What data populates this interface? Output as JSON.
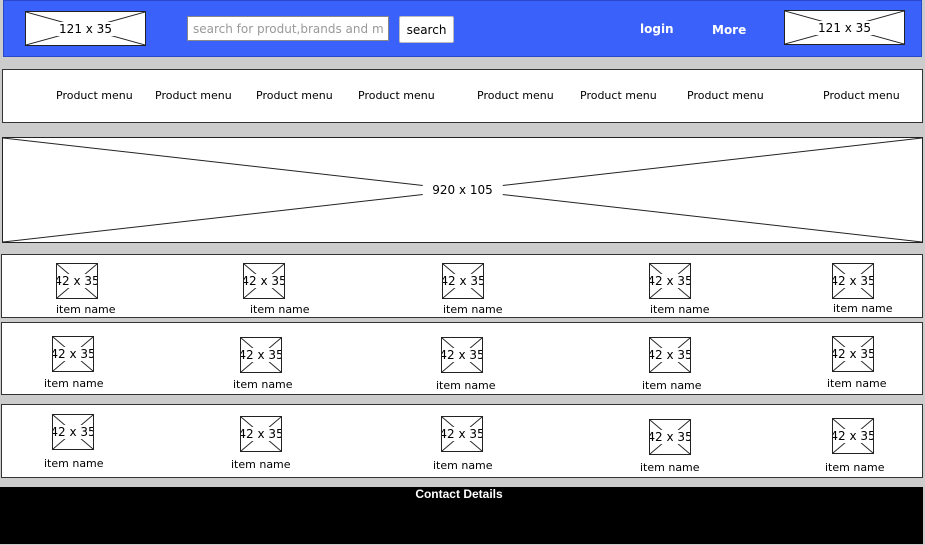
{
  "header": {
    "logo_placeholder": "121 x 35",
    "search": {
      "placeholder": "search for produt,brands and more",
      "button_label": "search"
    },
    "login_label": "login",
    "more_label": "More",
    "cart_placeholder": "121 x 35"
  },
  "menu": {
    "items": [
      "Product menu",
      "Product menu",
      "Product menu",
      "Product menu",
      "Product menu",
      "Product menu",
      "Product menu",
      "Product menu"
    ]
  },
  "banner": {
    "placeholder": "920 x 105"
  },
  "product_rows": [
    {
      "items": [
        {
          "thumb": "42 x 35",
          "name": "item name"
        },
        {
          "thumb": "42 x 35",
          "name": "item name"
        },
        {
          "thumb": "42 x 35",
          "name": "item name"
        },
        {
          "thumb": "42 x 35",
          "name": "item name"
        },
        {
          "thumb": "42 x 35",
          "name": "item name"
        }
      ]
    },
    {
      "items": [
        {
          "thumb": "42 x 35",
          "name": "item name"
        },
        {
          "thumb": "42 x 35",
          "name": "item name"
        },
        {
          "thumb": "42 x 35",
          "name": "item name"
        },
        {
          "thumb": "42 x 35",
          "name": "item name"
        },
        {
          "thumb": "42 x 35",
          "name": "item name"
        }
      ]
    },
    {
      "items": [
        {
          "thumb": "42 x 35",
          "name": "item name"
        },
        {
          "thumb": "42 x 35",
          "name": "item name"
        },
        {
          "thumb": "42 x 35",
          "name": "item name"
        },
        {
          "thumb": "42 x 35",
          "name": "item name"
        },
        {
          "thumb": "42 x 35",
          "name": "item name"
        }
      ]
    }
  ],
  "footer": {
    "title": "Contact Details"
  },
  "colors": {
    "header_bg": "#3b61fb",
    "page_bg": "#cccccc",
    "footer_bg": "#000000"
  }
}
